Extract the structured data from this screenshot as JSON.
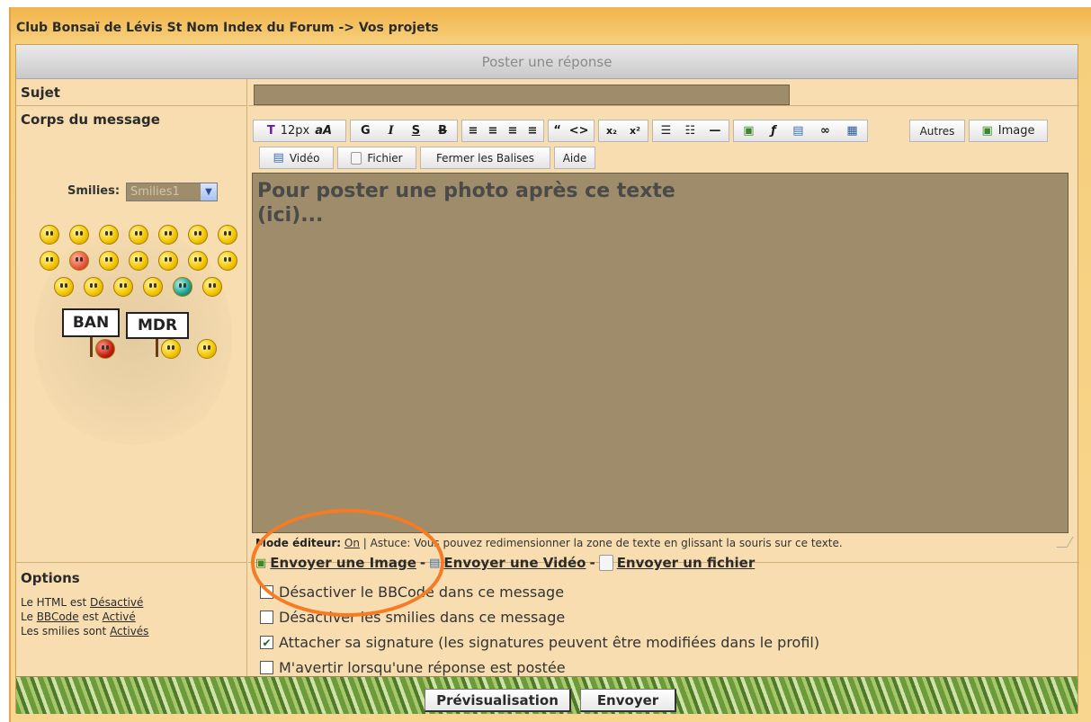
{
  "breadcrumb": {
    "forum_index": "Club Bonsaï de Lévis St Nom Index du Forum",
    "separator": "->",
    "section": "Vos projets"
  },
  "panel": {
    "title": "Poster une réponse"
  },
  "subject": {
    "label": "Sujet",
    "value": ""
  },
  "body": {
    "label": "Corps du message",
    "text": "Pour poster une photo après ce texte\n(ici)..."
  },
  "smilies": {
    "label": "Smilies:",
    "selected": "Smilies1",
    "sign_ban": "BAN",
    "sign_mdr": "MDR"
  },
  "toolbar": {
    "font_size": "12px",
    "bold": "G",
    "italic": "I",
    "underline": "S",
    "strike": "B",
    "autres": "Autres",
    "image": "Image",
    "video": "Vidéo",
    "fichier": "Fichier",
    "fermer_balises": "Fermer les Balises",
    "aide": "Aide"
  },
  "editor_hint": {
    "mode_label": "Mode éditeur:",
    "mode_value": "On",
    "tip": "| Astuce: Vous pouvez redimensionner la zone de texte en glissant la souris sur ce texte."
  },
  "upload": {
    "image": "Envoyer une Image",
    "video": "Envoyer une Vidéo",
    "file": "Envoyer un fichier",
    "sep": "-"
  },
  "options": {
    "title": "Options",
    "html_prefix": "Le HTML est",
    "html_state": "Désactivé",
    "bbcode_prefix": "Le",
    "bbcode_word": "BBCode",
    "bbcode_mid": "est",
    "bbcode_state": "Activé",
    "smilies_prefix": "Les smilies sont",
    "smilies_state": "Activés",
    "check_bbcode": "Désactiver le BBCode dans ce message",
    "check_smilies": "Désactiver les smilies dans ce message",
    "check_signature": "Attacher sa signature (les signatures peuvent être modifiées dans le profil)",
    "check_notify": "M'avertir lorsqu'une réponse est postée",
    "signature_checked": true
  },
  "footer": {
    "preview": "Prévisualisation",
    "send": "Envoyer"
  },
  "colors": {
    "accent_circle": "#f57c24",
    "textarea_bg": "#9e8c6a"
  }
}
